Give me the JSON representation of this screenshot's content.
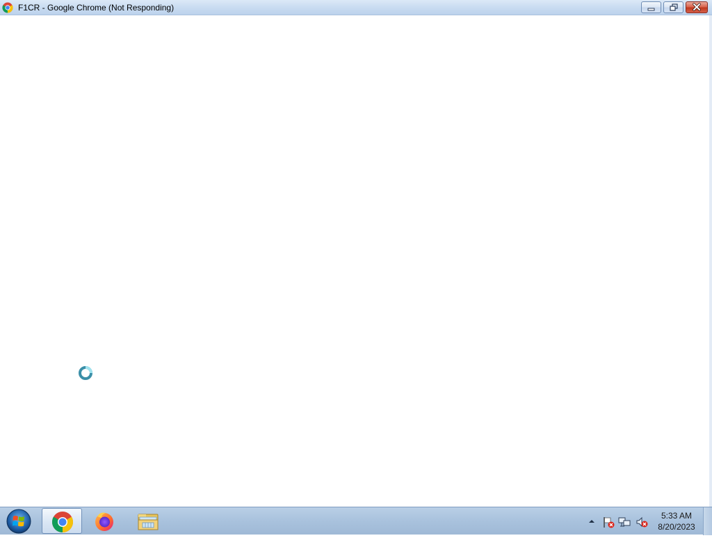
{
  "window": {
    "title": "F1CR - Google Chrome (Not Responding)",
    "icon": "chrome-icon",
    "controls": {
      "minimize_icon": "minimize-icon",
      "restore_icon": "restore-icon",
      "close_icon": "close-icon"
    }
  },
  "content": {
    "cursor": "busy-cursor-icon"
  },
  "taskbar": {
    "start_icon": "windows-start-icon",
    "pinned": [
      {
        "app": "Google Chrome",
        "icon": "chrome-icon",
        "active": true
      },
      {
        "app": "Firefox",
        "icon": "firefox-icon",
        "active": false
      },
      {
        "app": "File Explorer",
        "icon": "folder-icon",
        "active": false
      }
    ],
    "tray": {
      "icons": [
        "show-hidden-icons-arrow",
        "action-center-flag-icon",
        "network-icon",
        "volume-muted-icon"
      ]
    },
    "clock": {
      "time": "5:33 AM",
      "date": "8/20/2023"
    }
  },
  "colors": {
    "titlebar": "#c9dcf1",
    "taskbar": "#a9c2dd",
    "close_button": "#c0391f"
  }
}
